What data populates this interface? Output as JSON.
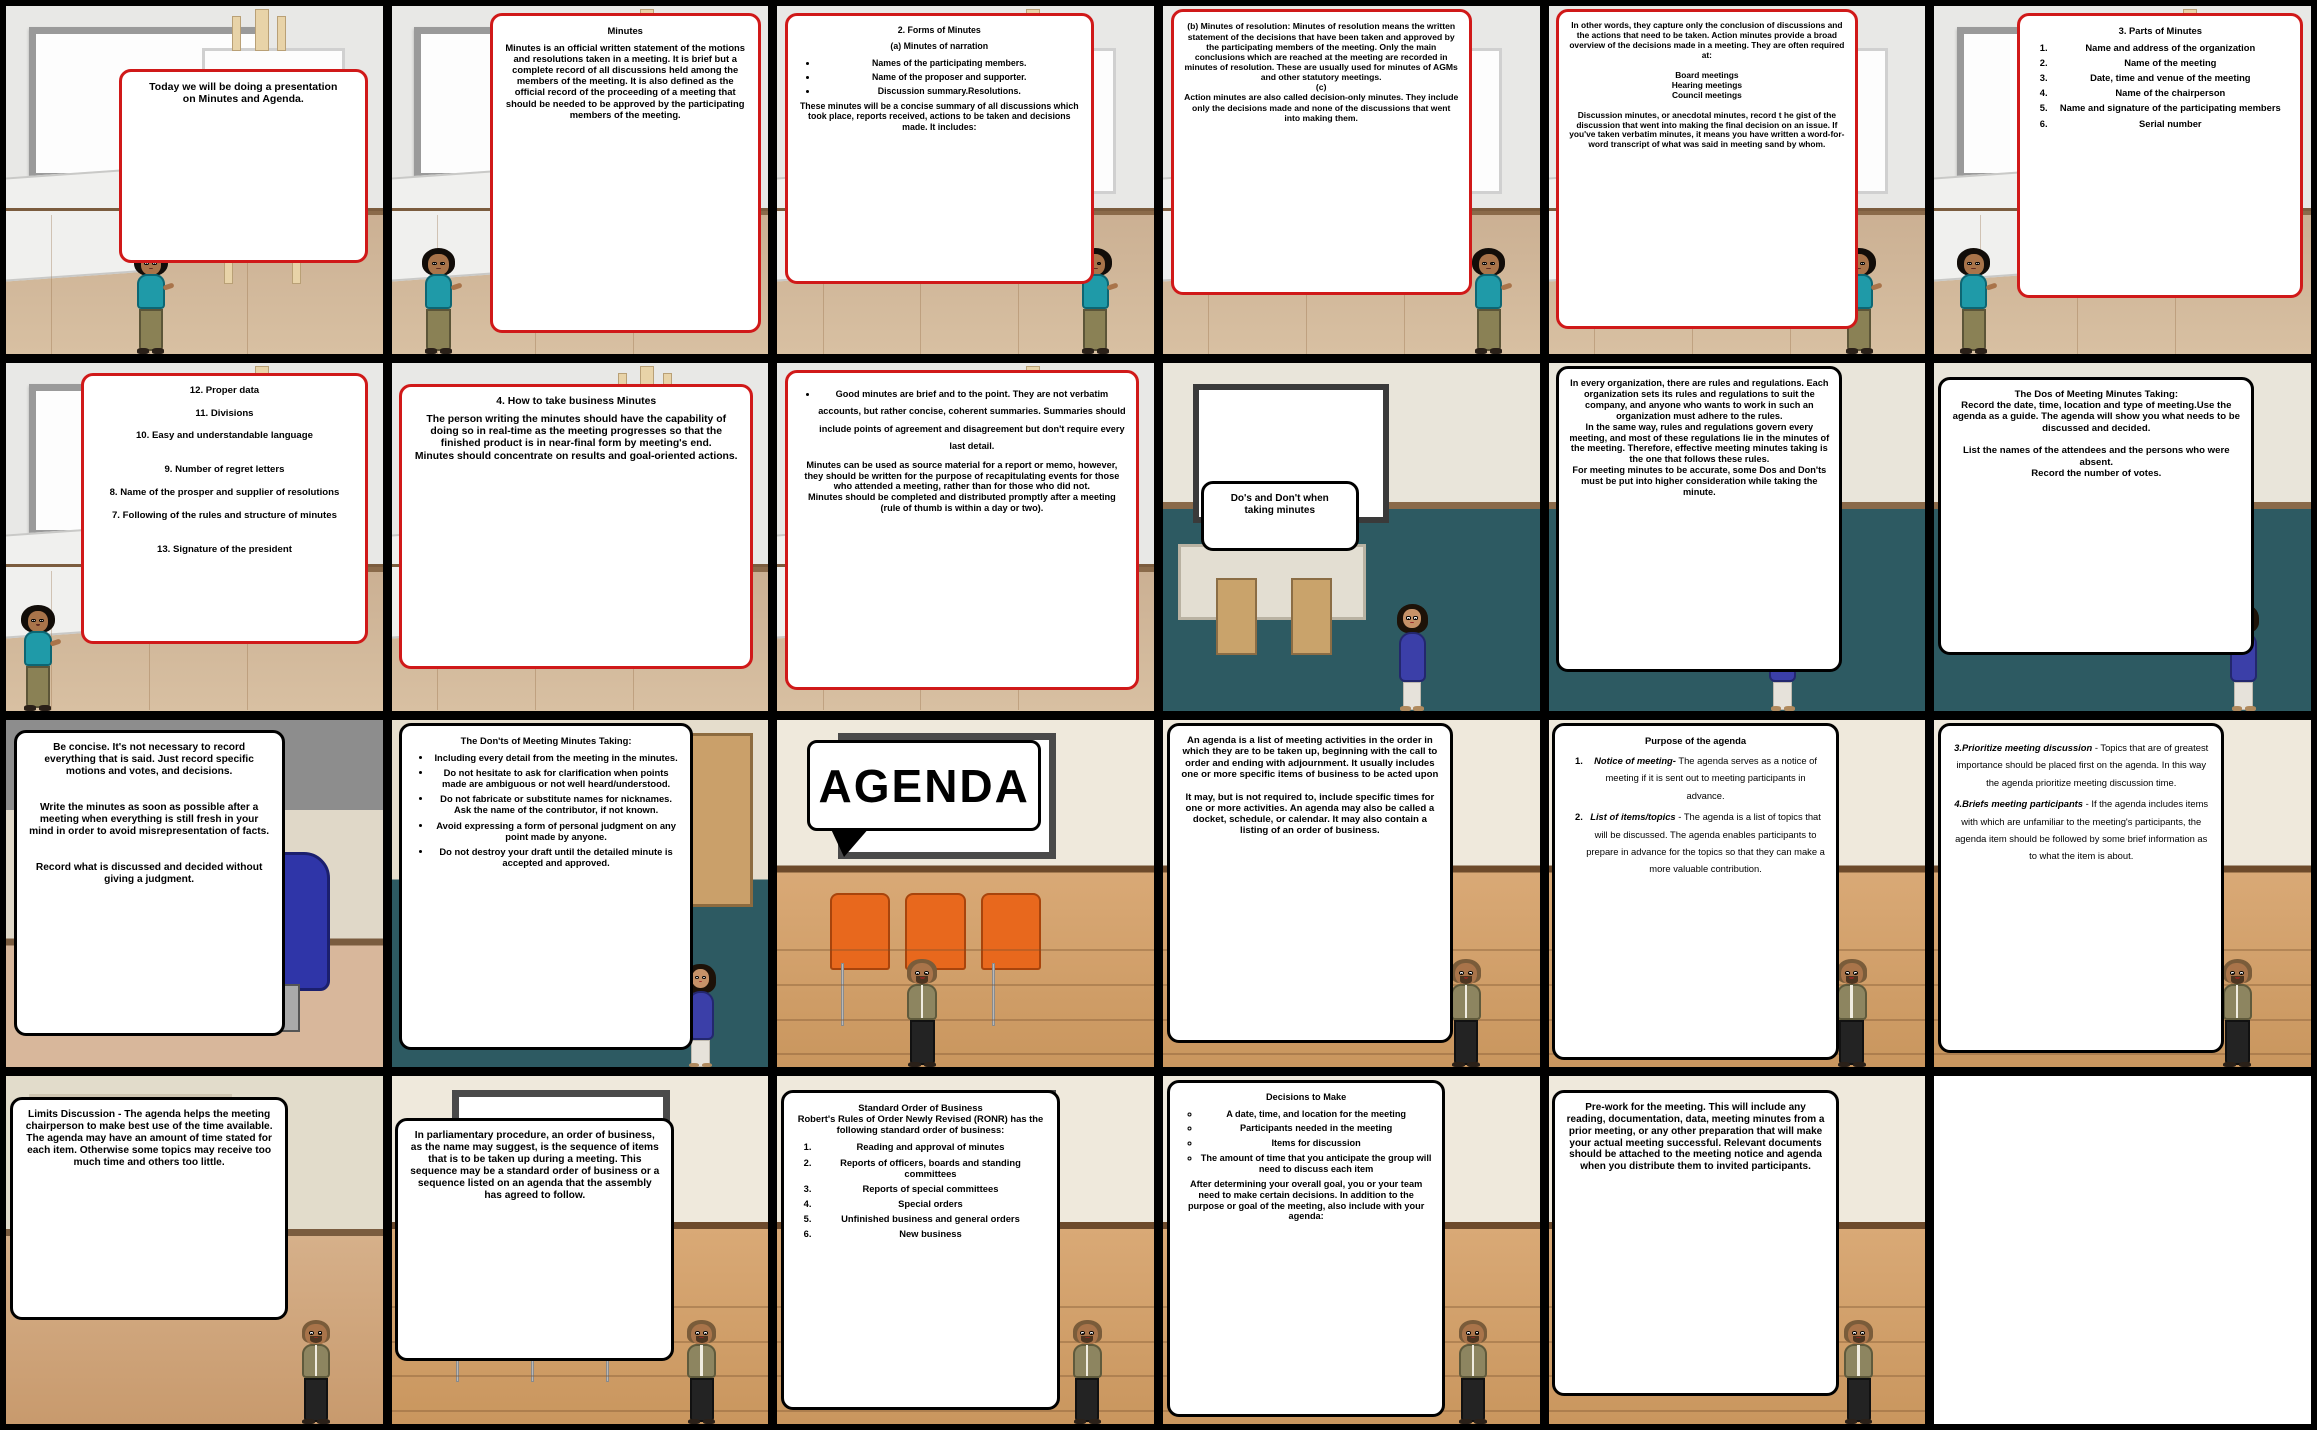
{
  "title": "Minutes and Agenda Storyboard",
  "panels": [
    {
      "id": 1,
      "scene": "classroom",
      "bubble_style": "red",
      "title": "",
      "body": "Today we will be doing a presentation\non Minutes and Agenda."
    },
    {
      "id": 2,
      "scene": "classroom",
      "bubble_style": "red",
      "title": "Minutes",
      "body": "Minutes is an official written statement of the motions and resolutions taken in a meeting. It is brief but a complete record of all discussions held among the members of the meeting. It is also defined as the official record of the proceeding of a meeting that should be needed to be approved by the participating members of the meeting."
    },
    {
      "id": 3,
      "scene": "classroom",
      "bubble_style": "red",
      "title": "2.  Forms of Minutes",
      "subtitle": "(a)   Minutes of narration",
      "body": "These minutes will be a concise summary of all discussions which took place, reports received, actions to be taken and decisions made. It includes:",
      "bullets": [
        "Names of the participating members.",
        "Name of the proposer and supporter.",
        "Discussion summary.Resolutions."
      ]
    },
    {
      "id": 4,
      "scene": "classroom",
      "bubble_style": "red",
      "title": "",
      "body": "(b)    Minutes of resolution: Minutes of resolution means the written statement of the decisions    that have been taken and approved by the participating members of the meeting. Only the main conclusions which are reached at the meeting are recorded in minutes of resolution. These are usually used for minutes of AGMs and other statutory meetings.\n(c)\nAction minutes are also called decision-only minutes. They include only the decisions made and none of the discussions that went into making them."
    },
    {
      "id": 5,
      "scene": "classroom",
      "bubble_style": "red",
      "title": "",
      "body": "In other words, they capture only the conclusion of discussions and the actions that need  to be taken. Action minutes provide a broad overview of the decisions made in a meeting. They are often required at:\n\nBoard meetings\nHearing meetings\nCouncil meetings\n\nDiscussion minutes, or anecdotal minutes, record t he gist of the discussion that went into making the final decision on an issue. If you've taken verbatim minutes, it means you have written a word-for-word transcript of what was said in meeting sand by whom."
    },
    {
      "id": 6,
      "scene": "classroom",
      "bubble_style": "red",
      "title": "3. Parts of  Minutes",
      "numbered": [
        "Name and address of the organization",
        "Name of the meeting",
        "Date, time and venue of the meeting",
        "Name of the chairperson",
        "Name and signature of the participating members",
        "Serial number"
      ]
    },
    {
      "id": 7,
      "scene": "classroom",
      "bubble_style": "red",
      "title": "",
      "body": "12.  Proper data\n\n11.  Divisions\n\n10.  Easy and understandable language\n\n\n9.      Number of regret letters\n\n8.      Name of the prosper and supplier of resolutions\n\n7.      Following of the rules and structure of minutes\n\n\n13.  Signature of the president"
    },
    {
      "id": 8,
      "scene": "classroom",
      "bubble_style": "red",
      "title": "4. How to take business Minutes",
      "body": "The person writing the minutes should have the capability of doing so in real-time as the meeting progresses so that the finished product is in near-final form by meeting's end.\nMinutes should concentrate on results and goal-oriented actions."
    },
    {
      "id": 9,
      "scene": "classroom",
      "bubble_style": "red",
      "title": "",
      "bullets": [
        "Good minutes are brief and to the point. They are not verbatim accounts, but rather concise, coherent summaries. Summaries should include points of agreement and disagreement but don't require every last detail."
      ],
      "body": "Minutes can be used as source material for a report or     memo, however, they should be written for the purpose of recapitulating events for those who attended a meeting, rather than for those who did not.\nMinutes should be completed and distributed promptly after a meeting (rule of thumb is within a day or two)."
    },
    {
      "id": 10,
      "scene": "teal",
      "bubble_style": "black",
      "title": "",
      "body": "Do's and Don't when\ntaking minutes"
    },
    {
      "id": 11,
      "scene": "teal",
      "bubble_style": "black",
      "title": "",
      "body": "In every organization, there are rules and regulations. Each organization sets its rules and regulations to suit the company, and anyone who wants to work in such an organization must adhere to the rules.\nIn the same way, rules and regulations govern every meeting, and most of these regulations lie in the minutes of the meeting. Therefore, effective meeting minutes taking is the one that follows these rules.\nFor meeting minutes to be accurate, some Dos and Don'ts must be put into higher consideration while taking the minute."
    },
    {
      "id": 12,
      "scene": "teal",
      "bubble_style": "black",
      "title": "",
      "body": "The Dos of Meeting Minutes Taking:\nRecord the date, time, location and type of meeting.Use the agenda as a guide. The agenda will show you what needs to be discussed and decided.\n\nList the names of the attendees and the persons who were absent.\nRecord the number of votes."
    },
    {
      "id": 13,
      "scene": "office",
      "bubble_style": "black",
      "title": "",
      "body": "Be concise. It's not necessary to record everything that is said. Just record specific motions and votes, and decisions.\n\n\nWrite the minutes as soon as possible after a meeting when everything is still fresh in your mind in order to avoid misrepresentation of facts.\n\n\nRecord what is discussed and decided without giving a judgment."
    },
    {
      "id": 14,
      "scene": "darkteal",
      "bubble_style": "black",
      "title": "The Don'ts of Meeting Minutes Taking:",
      "bullets": [
        "Including every detail from the meeting in the minutes.",
        "Do not hesitate to ask for clarification when points made are ambiguous or not well heard/understood.",
        "Do not fabricate or substitute names for nicknames. Ask the name of the contributor, if not known.",
        "Avoid expressing a form of personal judgment on any point made by anyone.",
        "Do not destroy your draft until the detailed minute is accepted and approved."
      ]
    },
    {
      "id": 15,
      "scene": "meeting",
      "bubble_style": "banner",
      "banner_text": "AGENDA"
    },
    {
      "id": 16,
      "scene": "meeting",
      "bubble_style": "black",
      "title": "",
      "body": "An agenda is a list of meeting activities in the order in which they are to be taken up, beginning with the call to order and ending with adjournment. It usually includes one or more specific items of business to be acted upon\n\nIt may, but is not required to, include specific times for one or more activities. An agenda may also be called a docket, schedule, or calendar. It may also contain a listing of an order of business."
    },
    {
      "id": 17,
      "scene": "meeting",
      "bubble_style": "black",
      "title": "Purpose of the agenda",
      "numbered_rich": [
        {
          "lead": "Notice of meeting-",
          "rest": " The agenda serves as a notice of meeting if it is sent out to meeting participants in advance."
        },
        {
          "lead": "List of items/topics",
          "rest": " - The agenda is a list of topics that will be discussed. The agenda enables participants to prepare in advance for the topics so that they can make a more valuable contribution."
        }
      ]
    },
    {
      "id": 18,
      "scene": "meeting",
      "bubble_style": "black",
      "rich_paragraphs": [
        {
          "lead": "3.Prioritize meeting discussion",
          "rest": " - Topics that are of greatest importance should be placed first on the agenda. In this way the agenda prioritize meeting discussion time."
        },
        {
          "lead": "4.Briefs meeting participants",
          "rest": " - If the agenda includes items with which are unfamiliar to the meeting's participants, the agenda item should be followed by some brief information as to what the item is about."
        }
      ]
    },
    {
      "id": 19,
      "scene": "office-light",
      "bubble_style": "black",
      "title": "",
      "body": "Limits Discussion - The agenda helps the meeting chairperson to make best use of the time available. The agenda may have an amount of time stated for each item. Otherwise some topics may receive too much time and others too little."
    },
    {
      "id": 20,
      "scene": "meeting",
      "bubble_style": "black",
      "title": "",
      "body": "In parliamentary procedure, an order of business, as the name may suggest, is the sequence of items that is to be taken up during a meeting. This sequence may be a standard order of business or a sequence listed on an agenda that the assembly has agreed to follow."
    },
    {
      "id": 21,
      "scene": "meeting",
      "bubble_style": "black",
      "title": "Standard Order of Business\nRobert's Rules of Order Newly Revised (RONR) has the following standard order of business:",
      "numbered": [
        "Reading and approval of minutes",
        "Reports of officers, boards and standing committees",
        "Reports of special committees",
        "Special orders",
        "Unfinished business and general orders",
        "New business"
      ]
    },
    {
      "id": 22,
      "scene": "meeting",
      "bubble_style": "black",
      "title": "Decisions to Make",
      "body": "After determining your overall goal, you or your team need to make certain decisions. In addition to the purpose or goal of the meeting, also include with your agenda:",
      "circle_bullets": [
        "A date, time, and location for the meeting",
        "Participants needed in the meeting",
        "Items for discussion",
        "The amount of time that you anticipate the group will need to discuss each item"
      ]
    },
    {
      "id": 23,
      "scene": "meeting",
      "bubble_style": "black",
      "title": "",
      "body": "Pre-work for the meeting. This will include any reading, documentation, data, meeting minutes from a prior meeting, or any other preparation that will make your actual meeting successful. Relevant documents should be attached to the meeting notice and agenda when you distribute them to invited participants."
    },
    {
      "id": 24,
      "scene": "blank",
      "bubble_style": "none"
    }
  ],
  "colors": {
    "bubble_red": "#d01919",
    "bubble_black": "#000000",
    "panel_gap": "#000000",
    "teal_wall": "#2d5a62",
    "orange_chair": "#e8681d",
    "wood_floor": "#c9965e"
  }
}
